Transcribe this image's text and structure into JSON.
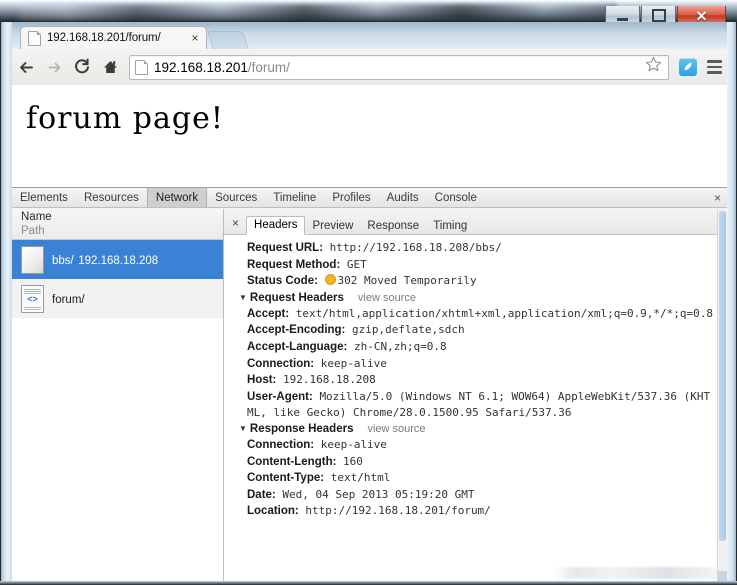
{
  "window": {
    "minimize_label": "–",
    "maximize_label": "□",
    "close_label": "✕"
  },
  "browser": {
    "tab": {
      "title": "192.168.18.201/forum/",
      "close_label": "×"
    },
    "toolbar": {
      "back_label": "Back",
      "forward_label": "Forward",
      "reload_label": "Reload",
      "home_label": "Home",
      "url_host": "192.168.18.201",
      "url_path": "/forum/",
      "bookmark_label": "Bookmark this page",
      "extension_label": "Extension",
      "menu_label": "Customize and control Google Chrome"
    }
  },
  "page": {
    "heading": "forum page!"
  },
  "devtools": {
    "tabs": [
      {
        "label": "Elements",
        "selected": false
      },
      {
        "label": "Resources",
        "selected": false
      },
      {
        "label": "Network",
        "selected": true
      },
      {
        "label": "Sources",
        "selected": false
      },
      {
        "label": "Timeline",
        "selected": false
      },
      {
        "label": "Profiles",
        "selected": false
      },
      {
        "label": "Audits",
        "selected": false
      },
      {
        "label": "Console",
        "selected": false
      }
    ],
    "close_label": "×",
    "requests": {
      "header_name": "Name",
      "header_path": "Path",
      "rows": [
        {
          "name": "bbs/",
          "path": "192.168.18.208",
          "selected": true,
          "icon": "plain-document-icon"
        },
        {
          "name": "forum/",
          "path": "",
          "selected": false,
          "icon": "code-document-icon"
        }
      ]
    },
    "detail": {
      "close_label": "×",
      "tabs": [
        {
          "label": "Headers",
          "selected": true
        },
        {
          "label": "Preview",
          "selected": false
        },
        {
          "label": "Response",
          "selected": false
        },
        {
          "label": "Timing",
          "selected": false
        }
      ],
      "general": [
        {
          "key": "Request URL:",
          "value": "http://192.168.18.208/bbs/"
        },
        {
          "key": "Request Method:",
          "value": "GET"
        }
      ],
      "status": {
        "key": "Status Code:",
        "value": "302 Moved Temporarily",
        "dot_color": "#f0b429"
      },
      "request_headers": {
        "title": "Request Headers",
        "view_source": "view source",
        "items": [
          {
            "key": "Accept:",
            "value": "text/html,application/xhtml+xml,application/xml;q=0.9,*/*;q=0.8"
          },
          {
            "key": "Accept-Encoding:",
            "value": "gzip,deflate,sdch"
          },
          {
            "key": "Accept-Language:",
            "value": "zh-CN,zh;q=0.8"
          },
          {
            "key": "Connection:",
            "value": "keep-alive"
          },
          {
            "key": "Host:",
            "value": "192.168.18.208"
          },
          {
            "key": "User-Agent:",
            "value": "Mozilla/5.0 (Windows NT 6.1; WOW64) AppleWebKit/537.36 (KHTML, like Gecko) Chrome/28.0.1500.95 Safari/537.36"
          }
        ]
      },
      "response_headers": {
        "title": "Response Headers",
        "view_source": "view source",
        "items": [
          {
            "key": "Connection:",
            "value": "keep-alive"
          },
          {
            "key": "Content-Length:",
            "value": "160"
          },
          {
            "key": "Content-Type:",
            "value": "text/html"
          },
          {
            "key": "Date:",
            "value": "Wed, 04 Sep 2013 05:19:20 GMT"
          },
          {
            "key": "Location:",
            "value": "http://192.168.18.201/forum/"
          }
        ]
      }
    }
  }
}
